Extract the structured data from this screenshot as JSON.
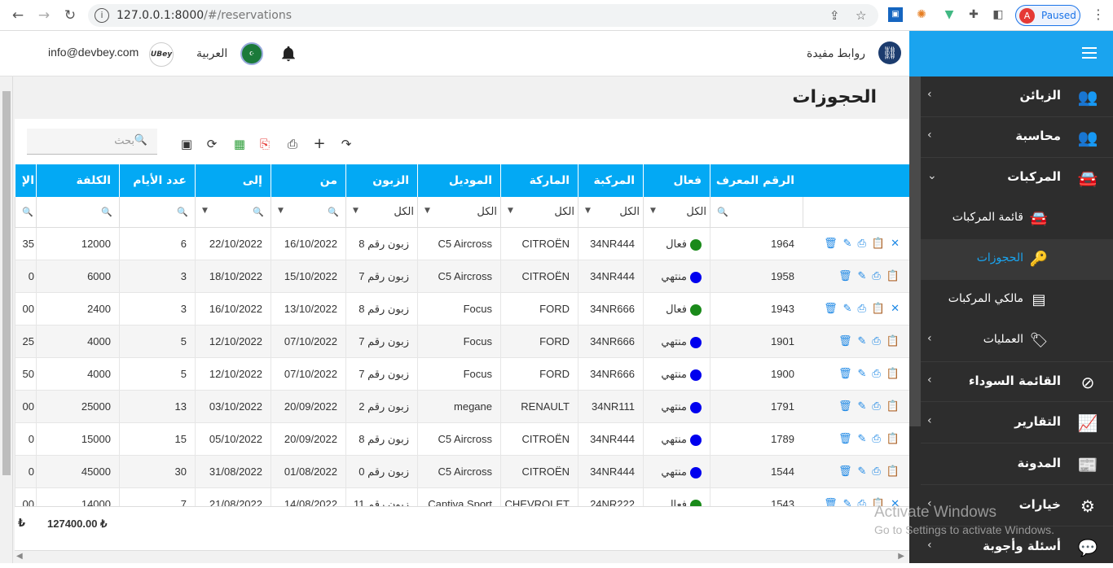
{
  "browser": {
    "url_scheme": "127.0.0.1:8000",
    "url_path": "/#/reservations",
    "profile_initial": "A",
    "profile_status": "Paused"
  },
  "topbar": {
    "email": "info@devbey.com",
    "logo_text": "UBey",
    "language": "العربية",
    "useful_links": "روابط مفيدة"
  },
  "sidebar": {
    "items": [
      {
        "label": "الزبائن",
        "icon": "users-icon"
      },
      {
        "label": "محاسبة",
        "icon": "users-icon"
      },
      {
        "label": "المركبات",
        "icon": "car-icon"
      },
      {
        "label": "القائمة السوداء",
        "icon": "ban-icon"
      },
      {
        "label": "التقارير",
        "icon": "chart-icon"
      },
      {
        "label": "المدونة",
        "icon": "newspaper-icon"
      },
      {
        "label": "خيارات",
        "icon": "gears-icon"
      },
      {
        "label": "أسئلة وأجوبة",
        "icon": "comments-icon"
      }
    ],
    "sub_items": [
      {
        "label": "قائمة المركبات",
        "icon": "car-icon"
      },
      {
        "label": "الحجوزات",
        "icon": "key-icon"
      },
      {
        "label": "مالكي المركبات",
        "icon": "id-card-icon"
      },
      {
        "label": "العمليات",
        "icon": "tags-icon"
      }
    ]
  },
  "watermark": {
    "line1": "Activate Windows",
    "line2": "Go to Settings to activate Windows."
  },
  "page": {
    "title": "الحجوزات",
    "search_placeholder": "بحث"
  },
  "grid": {
    "columns": [
      "الرقم المعرف",
      "فعال",
      "المركبة",
      "الماركة",
      "الموديل",
      "الزبون",
      "من",
      "إلى",
      "عدد الأيام",
      "الكلفة",
      "الإ"
    ],
    "filter_all": "الكل",
    "rows": [
      {
        "id": "1964",
        "status": "فعال",
        "status_color": "#1a8a1a",
        "plate": "34NR444",
        "brand": "CITROËN",
        "model": "C5 Aircross",
        "customer": "زبون رقم 8",
        "from": "16/10/2022",
        "to": "22/10/2022",
        "days": "6",
        "cost": "12000",
        "extra": "35",
        "cancel": true
      },
      {
        "id": "1958",
        "status": "منتهي",
        "status_color": "#0000ee",
        "plate": "34NR444",
        "brand": "CITROËN",
        "model": "C5 Aircross",
        "customer": "زبون رقم 7",
        "from": "15/10/2022",
        "to": "18/10/2022",
        "days": "3",
        "cost": "6000",
        "extra": "0",
        "cancel": false
      },
      {
        "id": "1943",
        "status": "فعال",
        "status_color": "#1a8a1a",
        "plate": "34NR666",
        "brand": "FORD",
        "model": "Focus",
        "customer": "زبون رقم 8",
        "from": "13/10/2022",
        "to": "16/10/2022",
        "days": "3",
        "cost": "2400",
        "extra": "00",
        "cancel": true
      },
      {
        "id": "1901",
        "status": "منتهي",
        "status_color": "#0000ee",
        "plate": "34NR666",
        "brand": "FORD",
        "model": "Focus",
        "customer": "زبون رقم 7",
        "from": "07/10/2022",
        "to": "12/10/2022",
        "days": "5",
        "cost": "4000",
        "extra": "25",
        "cancel": false
      },
      {
        "id": "1900",
        "status": "منتهي",
        "status_color": "#0000ee",
        "plate": "34NR666",
        "brand": "FORD",
        "model": "Focus",
        "customer": "زبون رقم 7",
        "from": "07/10/2022",
        "to": "12/10/2022",
        "days": "5",
        "cost": "4000",
        "extra": "50",
        "cancel": false
      },
      {
        "id": "1791",
        "status": "منتهي",
        "status_color": "#0000ee",
        "plate": "34NR111",
        "brand": "RENAULT",
        "model": "megane",
        "customer": "زبون رقم 2",
        "from": "20/09/2022",
        "to": "03/10/2022",
        "days": "13",
        "cost": "25000",
        "extra": "00",
        "cancel": false
      },
      {
        "id": "1789",
        "status": "منتهي",
        "status_color": "#0000ee",
        "plate": "34NR444",
        "brand": "CITROËN",
        "model": "C5 Aircross",
        "customer": "زبون رقم 8",
        "from": "20/09/2022",
        "to": "05/10/2022",
        "days": "15",
        "cost": "15000",
        "extra": "0",
        "cancel": false
      },
      {
        "id": "1544",
        "status": "منتهي",
        "status_color": "#0000ee",
        "plate": "34NR444",
        "brand": "CITROËN",
        "model": "C5 Aircross",
        "customer": "زبون رقم 0",
        "from": "01/08/2022",
        "to": "31/08/2022",
        "days": "30",
        "cost": "45000",
        "extra": "0",
        "cancel": false
      },
      {
        "id": "1543",
        "status": "فعال",
        "status_color": "#1a8a1a",
        "plate": "24NR222",
        "brand": "CHEVROLET",
        "model": "Captiva Sport",
        "customer": "زبون رقم 11",
        "from": "14/08/2022",
        "to": "21/08/2022",
        "days": "7",
        "cost": "14000",
        "extra": "00",
        "cancel": true
      }
    ]
  },
  "footer": {
    "total": "127400.00 ₺",
    "currency": "₺"
  }
}
